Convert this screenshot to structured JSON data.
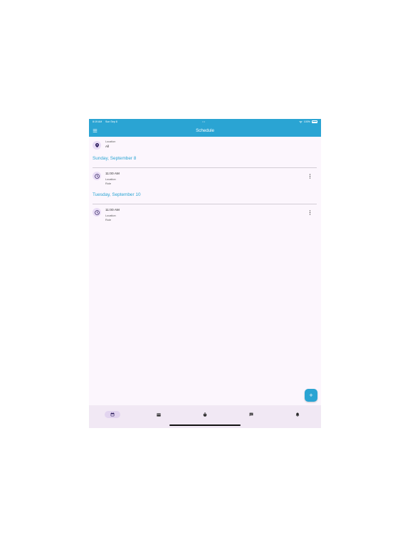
{
  "status_bar": {
    "time": "8:19 AM",
    "date": "Sun Sep 8",
    "center_dots": "•••",
    "battery": "100%"
  },
  "app_bar": {
    "title": "Schedule",
    "menu_icon": "hamburger-menu-icon"
  },
  "location_filter": {
    "label": "Location",
    "value": "All",
    "icon": "location-pin-icon"
  },
  "days": [
    {
      "date": "Sunday, September 8",
      "events": [
        {
          "time": "11:00 AM",
          "location": "Location",
          "role": "Role"
        }
      ]
    },
    {
      "date": "Tuesday, September 10",
      "events": [
        {
          "time": "11:00 AM",
          "location": "Location",
          "role": "Role"
        }
      ]
    }
  ],
  "fab": {
    "label": "+"
  },
  "bottom_nav": {
    "items": [
      {
        "icon": "calendar-icon",
        "active": true
      },
      {
        "icon": "card-icon",
        "active": false
      },
      {
        "icon": "timer-icon",
        "active": false
      },
      {
        "icon": "chat-icon",
        "active": false
      },
      {
        "icon": "bell-icon",
        "active": false
      }
    ]
  },
  "colors": {
    "primary": "#2aa4d3",
    "background": "#fcf6fd",
    "icon_bg": "#e9ddf6",
    "nav_bg": "#f1e8f4",
    "icon_dark": "#2b1c5c"
  }
}
